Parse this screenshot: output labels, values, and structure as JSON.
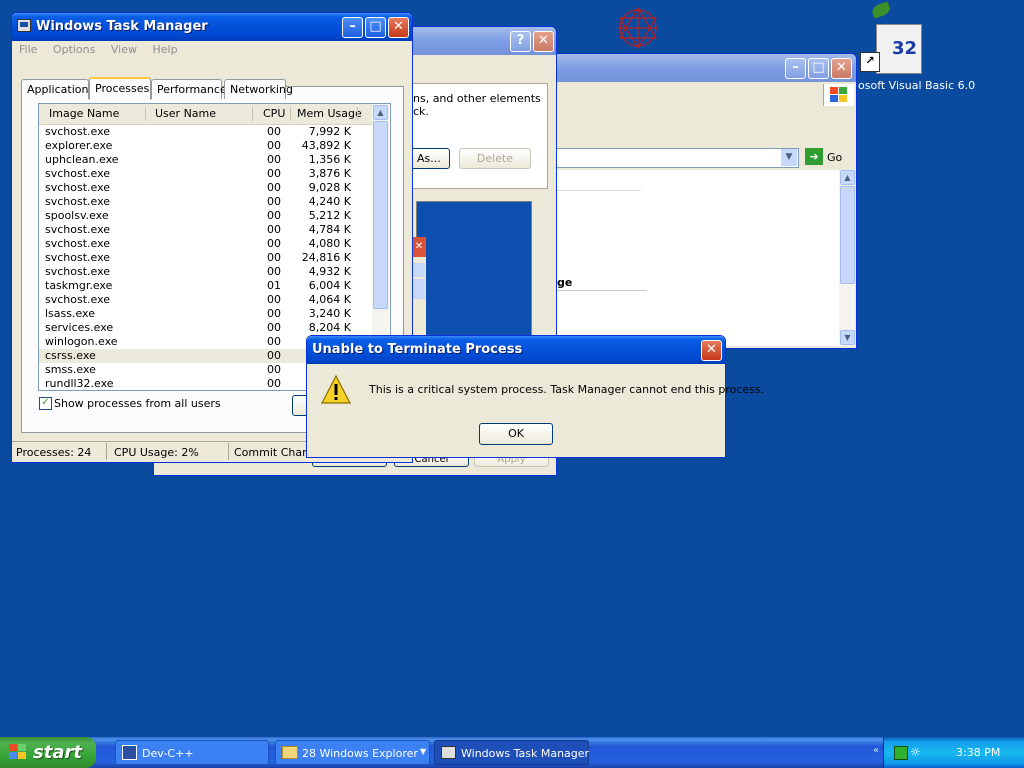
{
  "desktop": {
    "vb_icon_label": "osoft Visual Basic 6.0",
    "vb_icon_badge": "32"
  },
  "task_manager": {
    "title": "Windows Task Manager",
    "menu": [
      "File",
      "Options",
      "View",
      "Help"
    ],
    "tabs": [
      "Applications",
      "Processes",
      "Performance",
      "Networking"
    ],
    "selected_tab": "Processes",
    "columns": [
      "Image Name",
      "User Name",
      "CPU",
      "Mem Usage"
    ],
    "rows": [
      {
        "name": "svchost.exe",
        "cpu": "00",
        "mem": "7,992 K"
      },
      {
        "name": "explorer.exe",
        "cpu": "00",
        "mem": "43,892 K"
      },
      {
        "name": "uphclean.exe",
        "cpu": "00",
        "mem": "1,356 K"
      },
      {
        "name": "svchost.exe",
        "cpu": "00",
        "mem": "3,876 K"
      },
      {
        "name": "svchost.exe",
        "cpu": "00",
        "mem": "9,028 K"
      },
      {
        "name": "svchost.exe",
        "cpu": "00",
        "mem": "4,240 K"
      },
      {
        "name": "spoolsv.exe",
        "cpu": "00",
        "mem": "5,212 K"
      },
      {
        "name": "svchost.exe",
        "cpu": "00",
        "mem": "4,784 K"
      },
      {
        "name": "svchost.exe",
        "cpu": "00",
        "mem": "4,080 K"
      },
      {
        "name": "svchost.exe",
        "cpu": "00",
        "mem": "24,816 K"
      },
      {
        "name": "svchost.exe",
        "cpu": "00",
        "mem": "4,932 K"
      },
      {
        "name": "taskmgr.exe",
        "cpu": "01",
        "mem": "6,004 K"
      },
      {
        "name": "svchost.exe",
        "cpu": "00",
        "mem": "4,064 K"
      },
      {
        "name": "lsass.exe",
        "cpu": "00",
        "mem": "3,240 K"
      },
      {
        "name": "services.exe",
        "cpu": "00",
        "mem": "8,204 K"
      },
      {
        "name": "winlogon.exe",
        "cpu": "00",
        "mem": ""
      },
      {
        "name": "csrss.exe",
        "cpu": "00",
        "mem": "",
        "selected": true
      },
      {
        "name": "smss.exe",
        "cpu": "00",
        "mem": ""
      },
      {
        "name": "rundll32.exe",
        "cpu": "00",
        "mem": ""
      }
    ],
    "show_all_label": "Show processes from all users",
    "show_all_checked": true,
    "status": {
      "processes": "Processes: 24",
      "cpu": "CPU Usage: 2%",
      "commit": "Commit Charge"
    }
  },
  "dialog_back": {
    "text_fragment_1": "ns, and other elements",
    "text_fragment_2": "ck.",
    "save_as_fragment": "As...",
    "delete_label": "Delete",
    "cancel_fragment": "Cancel",
    "apply_fragment": "Apply"
  },
  "explorer_window": {
    "go_label": "Go",
    "text_fragment": "ge"
  },
  "error_dialog": {
    "title": "Unable to Terminate Process",
    "message": "This is a critical system process.  Task Manager cannot end this process.",
    "ok_label": "OK"
  },
  "taskbar": {
    "start_label": "start",
    "items": [
      {
        "label": "Dev-C++",
        "icon": "devcpp-icon"
      },
      {
        "label": "28 Windows Explorer",
        "icon": "folder-icon"
      },
      {
        "label": "Windows Task Manager",
        "icon": "taskmanager-icon"
      }
    ],
    "clock": "3:38 PM"
  },
  "colors": {
    "desktop": "#0a4ba0",
    "title_active": "#0450d8",
    "dialog_face": "#ece9d8",
    "selection_row": "#ebeadb"
  }
}
